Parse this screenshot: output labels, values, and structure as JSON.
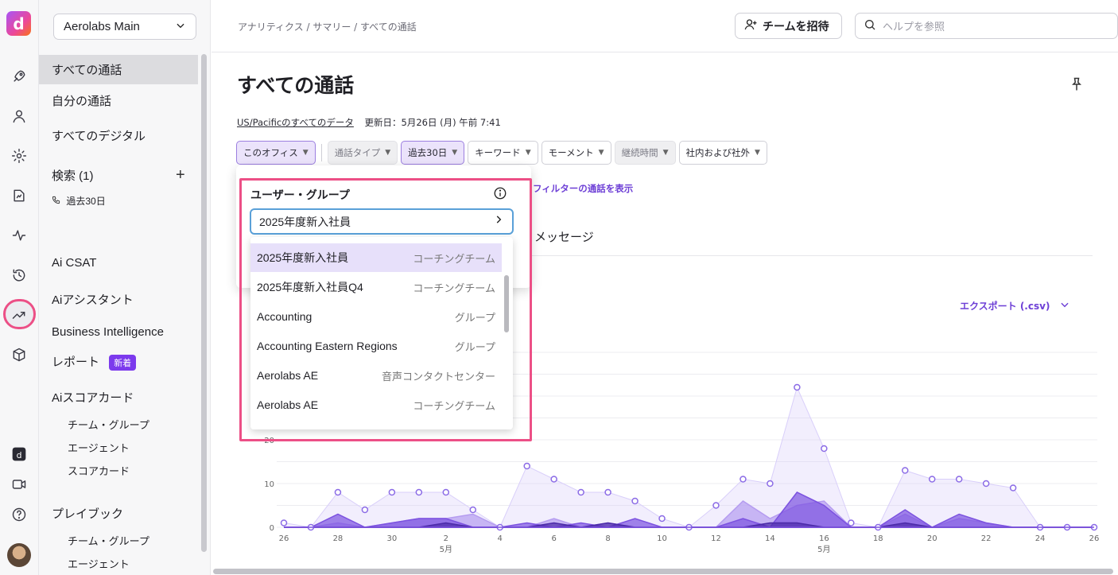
{
  "workspace": "Aerolabs Main",
  "sidebar": {
    "items": [
      {
        "label": "すべての通話"
      },
      {
        "label": "自分の通話"
      },
      {
        "label": "すべてのデジタル"
      },
      {
        "label": "検索 (1)"
      },
      {
        "label": "過去30日"
      },
      {
        "label": "Ai CSAT"
      },
      {
        "label": "Aiアシスタント"
      },
      {
        "label": "Business Intelligence"
      },
      {
        "label": "レポート",
        "badge": "新着"
      },
      {
        "label": "Aiスコアカード"
      },
      {
        "label": "チーム・グループ"
      },
      {
        "label": "エージェント"
      },
      {
        "label": "スコアカード"
      },
      {
        "label": "プレイブック"
      },
      {
        "label": "チーム・グループ"
      },
      {
        "label": "エージェント"
      }
    ]
  },
  "header": {
    "breadcrumb": "アナリティクス / サマリー / すべての通話",
    "invite_label": "チームを招待",
    "search_placeholder": "ヘルプを参照"
  },
  "main": {
    "title": "すべての通話",
    "timezone_link": "US/Pacificのすべてのデータ",
    "updated": "更新日：5月26日 (月) 午前 7:41",
    "filters": [
      {
        "label": "このオフィス",
        "state": "selected"
      },
      {
        "label": "通話タイプ",
        "state": "disabled"
      },
      {
        "label": "過去30日",
        "state": "selected"
      },
      {
        "label": "キーワード",
        "state": "normal"
      },
      {
        "label": "モーメント",
        "state": "normal"
      },
      {
        "label": "継続時間",
        "state": "disabled"
      },
      {
        "label": "社内および社外",
        "state": "normal"
      }
    ],
    "show_calls_link": "フィルターの通話を表示",
    "message_tab": "メッセージ",
    "export_label": "エクスポート (.csv)"
  },
  "dropdown": {
    "title": "ユーザー・グループ",
    "input_value": "2025年度新入社員",
    "options": [
      {
        "name": "2025年度新入社員",
        "type": "コーチングチーム",
        "selected": true
      },
      {
        "name": "2025年度新入社員Q4",
        "type": "コーチングチーム",
        "selected": false
      },
      {
        "name": "Accounting",
        "type": "グループ",
        "selected": false
      },
      {
        "name": "Accounting Eastern Regions",
        "type": "グループ",
        "selected": false
      },
      {
        "name": "Aerolabs AE",
        "type": "音声コンタクトセンター",
        "selected": false
      },
      {
        "name": "Aerolabs AE",
        "type": "コーチングチーム",
        "selected": false
      }
    ]
  },
  "chart_data": {
    "type": "area",
    "x": [
      "26",
      "27",
      "28",
      "29",
      "30",
      "1",
      "2",
      "3",
      "4",
      "5",
      "6",
      "7",
      "8",
      "9",
      "10",
      "11",
      "12",
      "13",
      "14",
      "15",
      "16",
      "17",
      "18",
      "19",
      "20",
      "21",
      "22",
      "23",
      "24",
      "25",
      "26"
    ],
    "month_labels": [
      {
        "index": 6,
        "label": "5月"
      },
      {
        "index": 20,
        "label": "5月"
      }
    ],
    "y_ticks": [
      "0",
      "10",
      "20"
    ],
    "ylim": [
      0,
      40
    ],
    "series": [
      {
        "values": [
          1,
          0,
          8,
          4,
          8,
          8,
          8,
          4,
          0,
          14,
          11,
          8,
          8,
          6,
          2,
          0,
          5,
          11,
          10,
          32,
          18,
          1,
          0,
          13,
          11,
          11,
          10,
          9,
          0,
          0,
          0
        ]
      },
      {
        "values": [
          0,
          0,
          1,
          0,
          1,
          2,
          2,
          3,
          0,
          0,
          2,
          0,
          1,
          0,
          0,
          0,
          0,
          6,
          2,
          5,
          6,
          0,
          0,
          3,
          0,
          2,
          1,
          0,
          0,
          0,
          0
        ]
      },
      {
        "values": [
          0,
          0,
          3,
          0,
          1,
          2,
          2,
          0,
          0,
          1,
          0,
          1,
          0,
          2,
          0,
          0,
          0,
          2,
          0,
          8,
          5,
          0,
          0,
          4,
          0,
          3,
          1,
          0,
          0,
          0,
          0
        ]
      },
      {
        "values": [
          0,
          0,
          0,
          0,
          0,
          0,
          1,
          0,
          0,
          0,
          1,
          0,
          1,
          0,
          0,
          0,
          0,
          0,
          1,
          1,
          0,
          0,
          0,
          1,
          0,
          0,
          0,
          0,
          0,
          0,
          0
        ]
      }
    ],
    "colors": [
      "#d9cffa",
      "#b59cf0",
      "#7c52e0",
      "#4b2aa8"
    ],
    "grid": true
  }
}
